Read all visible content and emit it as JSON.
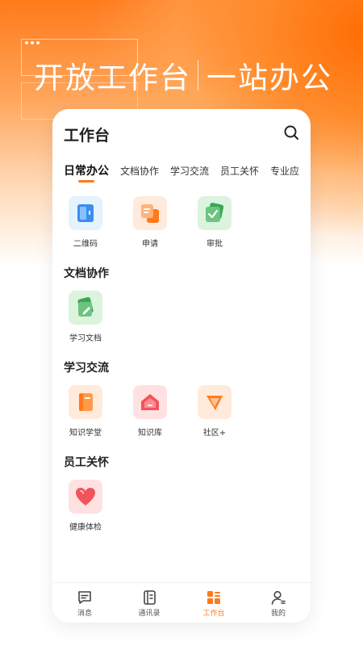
{
  "headline": {
    "part1": "开放工作台",
    "part2": "一站办公"
  },
  "card": {
    "title": "工作台"
  },
  "tabs": [
    {
      "label": "日常办公",
      "active": true
    },
    {
      "label": "文档协作",
      "active": false
    },
    {
      "label": "学习交流",
      "active": false
    },
    {
      "label": "员工关怀",
      "active": false
    },
    {
      "label": "专业应",
      "active": false
    }
  ],
  "sections": {
    "daily": {
      "apps": [
        {
          "label": "二维码",
          "icon": "qrcode-icon"
        },
        {
          "label": "申请",
          "icon": "apply-icon"
        },
        {
          "label": "审批",
          "icon": "approval-icon"
        }
      ]
    },
    "docs": {
      "title": "文档协作",
      "apps": [
        {
          "label": "学习文档",
          "icon": "doc-edit-icon"
        }
      ]
    },
    "learning": {
      "title": "学习交流",
      "apps": [
        {
          "label": "知识学堂",
          "icon": "book-icon"
        },
        {
          "label": "知识库",
          "icon": "house-icon"
        },
        {
          "label": "社区+",
          "icon": "megaphone-icon"
        }
      ]
    },
    "care": {
      "title": "员工关怀",
      "apps": [
        {
          "label": "健康体检",
          "icon": "heart-icon"
        }
      ]
    }
  },
  "tabbar": [
    {
      "label": "消息",
      "icon": "message-icon",
      "active": false
    },
    {
      "label": "通讯录",
      "icon": "contacts-icon",
      "active": false
    },
    {
      "label": "工作台",
      "icon": "workbench-icon",
      "active": true
    },
    {
      "label": "我的",
      "icon": "user-icon",
      "active": false
    }
  ],
  "colors": {
    "accent": "#ff7a1a",
    "title": "#222222"
  }
}
